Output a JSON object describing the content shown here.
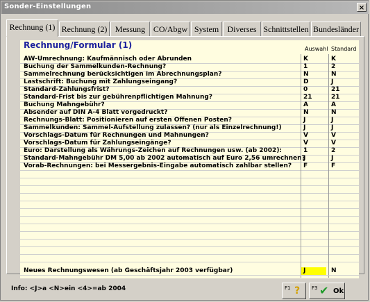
{
  "window": {
    "title": "Sonder-Einstellungen",
    "close_label": "×"
  },
  "tabs": [
    {
      "label": "Rechnung (1)"
    },
    {
      "label": "Rechnung (2)"
    },
    {
      "label": "Messung"
    },
    {
      "label": "CO/Abgw"
    },
    {
      "label": "System"
    },
    {
      "label": "Diverses"
    },
    {
      "label": "Schnittstellen"
    },
    {
      "label": "Bundesländer"
    }
  ],
  "panel": {
    "heading": "Rechnung/Formular (1)",
    "col_auswahl": "Auswahl",
    "col_standard": "Standard",
    "rows": [
      {
        "label": "AW-Umrechnung: Kaufmännisch oder Abrunden",
        "auswahl": "K",
        "standard": "K"
      },
      {
        "label": "Buchung der Sammelkunden-Rechnung?",
        "auswahl": "1",
        "standard": "2"
      },
      {
        "label": "Sammelrechnung berücksichtigen im Abrechnungsplan?",
        "auswahl": "N",
        "standard": "N"
      },
      {
        "label": "Lastschrift: Buchung mit Zahlungseingang?",
        "auswahl": "D",
        "standard": "J"
      },
      {
        "label": "Standard-Zahlungsfrist?",
        "auswahl": "0",
        "standard": "21"
      },
      {
        "label": "Standard-Frist bis zur gebührenpflichtigen Mahnung?",
        "auswahl": "21",
        "standard": "21"
      },
      {
        "label": "Buchung Mahngebühr?",
        "auswahl": "A",
        "standard": "A"
      },
      {
        "label": "Absender auf DIN A-4 Blatt vorgedruckt?",
        "auswahl": "N",
        "standard": "N"
      },
      {
        "label": "Rechnungs-Blatt: Positionieren auf ersten Offenen Posten?",
        "auswahl": "J",
        "standard": "J"
      },
      {
        "label": "Sammelkunden: Sammel-Aufstellung zulassen? (nur als Einzelrechnung!)",
        "auswahl": "J",
        "standard": "J"
      },
      {
        "label": "Vorschlags-Datum für Rechnungen und Mahnungen?",
        "auswahl": "V",
        "standard": "V"
      },
      {
        "label": "Vorschlags-Datum für Zahlungseingänge?",
        "auswahl": "V",
        "standard": "V"
      },
      {
        "label": "Euro: Darstellung als Währungs-Zeichen auf Rechnungen usw. (ab 2002):",
        "auswahl": "1",
        "standard": "2"
      },
      {
        "label": "Standard-Mahngebühr DM 5,00 ab 2002 automatisch auf Euro 2,56 umrechnen?",
        "auswahl": "J",
        "standard": "J"
      },
      {
        "label": "Vorab-Rechnungen: bei Messergebnis-Eingabe automatisch zahlbar stellen?",
        "auswahl": "F",
        "standard": "F"
      }
    ],
    "bottom_row": {
      "label": "Neues Rechnungswesen (ab Geschäftsjahr 2003 verfügbar)",
      "auswahl": "J",
      "standard": "N"
    }
  },
  "footer": {
    "info": "Info:  <J>a  <N>ein  <4>=ab 2004",
    "help_key": "F1",
    "help_icon": "?",
    "ok_key": "F3",
    "ok_label": "Ok"
  },
  "colors": {
    "grid_bg": "#fffde0",
    "heading": "#1a1f9c",
    "highlight": "#ffff00",
    "ok_check": "#1f9a2a"
  }
}
